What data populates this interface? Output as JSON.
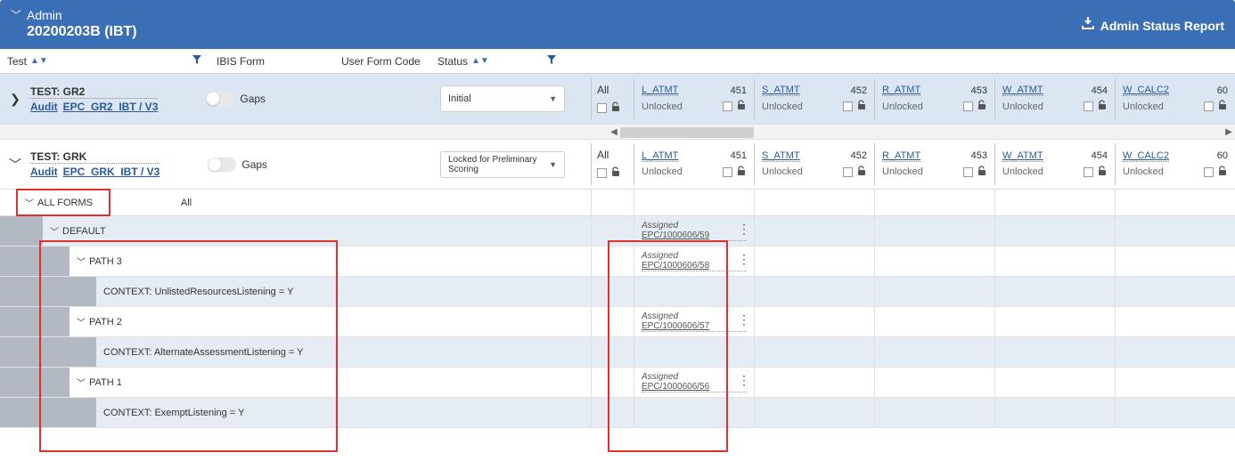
{
  "header": {
    "breadcrumb": "Admin",
    "title": "20200203B (IBT)",
    "report_button": "Admin Status Report"
  },
  "columns": {
    "test": "Test",
    "ibis_form": "IBIS Form",
    "user_form_code": "User Form Code",
    "status": "Status"
  },
  "sections": [
    {
      "name": "L_ATMT",
      "num": "451",
      "state": "Unlocked"
    },
    {
      "name": "S_ATMT",
      "num": "452",
      "state": "Unlocked"
    },
    {
      "name": "R_ATMT",
      "num": "453",
      "state": "Unlocked"
    },
    {
      "name": "W_ATMT",
      "num": "454",
      "state": "Unlocked"
    },
    {
      "name": "W_CALC2",
      "num": "60",
      "state": "Unlocked"
    }
  ],
  "all_label": "All",
  "tests": [
    {
      "expanded": false,
      "title": "TEST: GR2",
      "audit_label": "Audit",
      "form_link": "EPC_GR2_IBT / V3",
      "gaps_label": "Gaps",
      "status_value": "Initial"
    },
    {
      "expanded": true,
      "title": "TEST: GRK",
      "audit_label": "Audit",
      "form_link": "EPC_GRK_IBT / V3",
      "gaps_label": "Gaps",
      "status_value": "Locked for Preliminary Scoring"
    }
  ],
  "forms_header": {
    "all_forms": "ALL FORMS",
    "all": "All"
  },
  "tree": [
    {
      "level": 1,
      "alt": true,
      "chevron": true,
      "label": "DEFAULT",
      "assigned": "Assigned",
      "epc": "EPC/1000606/59",
      "kebab": true
    },
    {
      "level": 2,
      "alt": false,
      "chevron": true,
      "label": "PATH 3",
      "assigned": "Assigned",
      "epc": "EPC/1000606/58",
      "kebab": true
    },
    {
      "level": 3,
      "alt": true,
      "chevron": false,
      "label": "CONTEXT: UnlistedResourcesListening = Y",
      "assigned": "",
      "epc": "",
      "kebab": false
    },
    {
      "level": 2,
      "alt": false,
      "chevron": true,
      "label": "PATH 2",
      "assigned": "Assigned",
      "epc": "EPC/1000606/57",
      "kebab": true
    },
    {
      "level": 3,
      "alt": true,
      "chevron": false,
      "label": "CONTEXT: AlternateAssessmentListening = Y",
      "assigned": "",
      "epc": "",
      "kebab": false
    },
    {
      "level": 2,
      "alt": false,
      "chevron": true,
      "label": "PATH 1",
      "assigned": "Assigned",
      "epc": "EPC/1000606/56",
      "kebab": true
    },
    {
      "level": 3,
      "alt": true,
      "chevron": false,
      "label": "CONTEXT: ExemptListening = Y",
      "assigned": "",
      "epc": "",
      "kebab": false
    }
  ]
}
